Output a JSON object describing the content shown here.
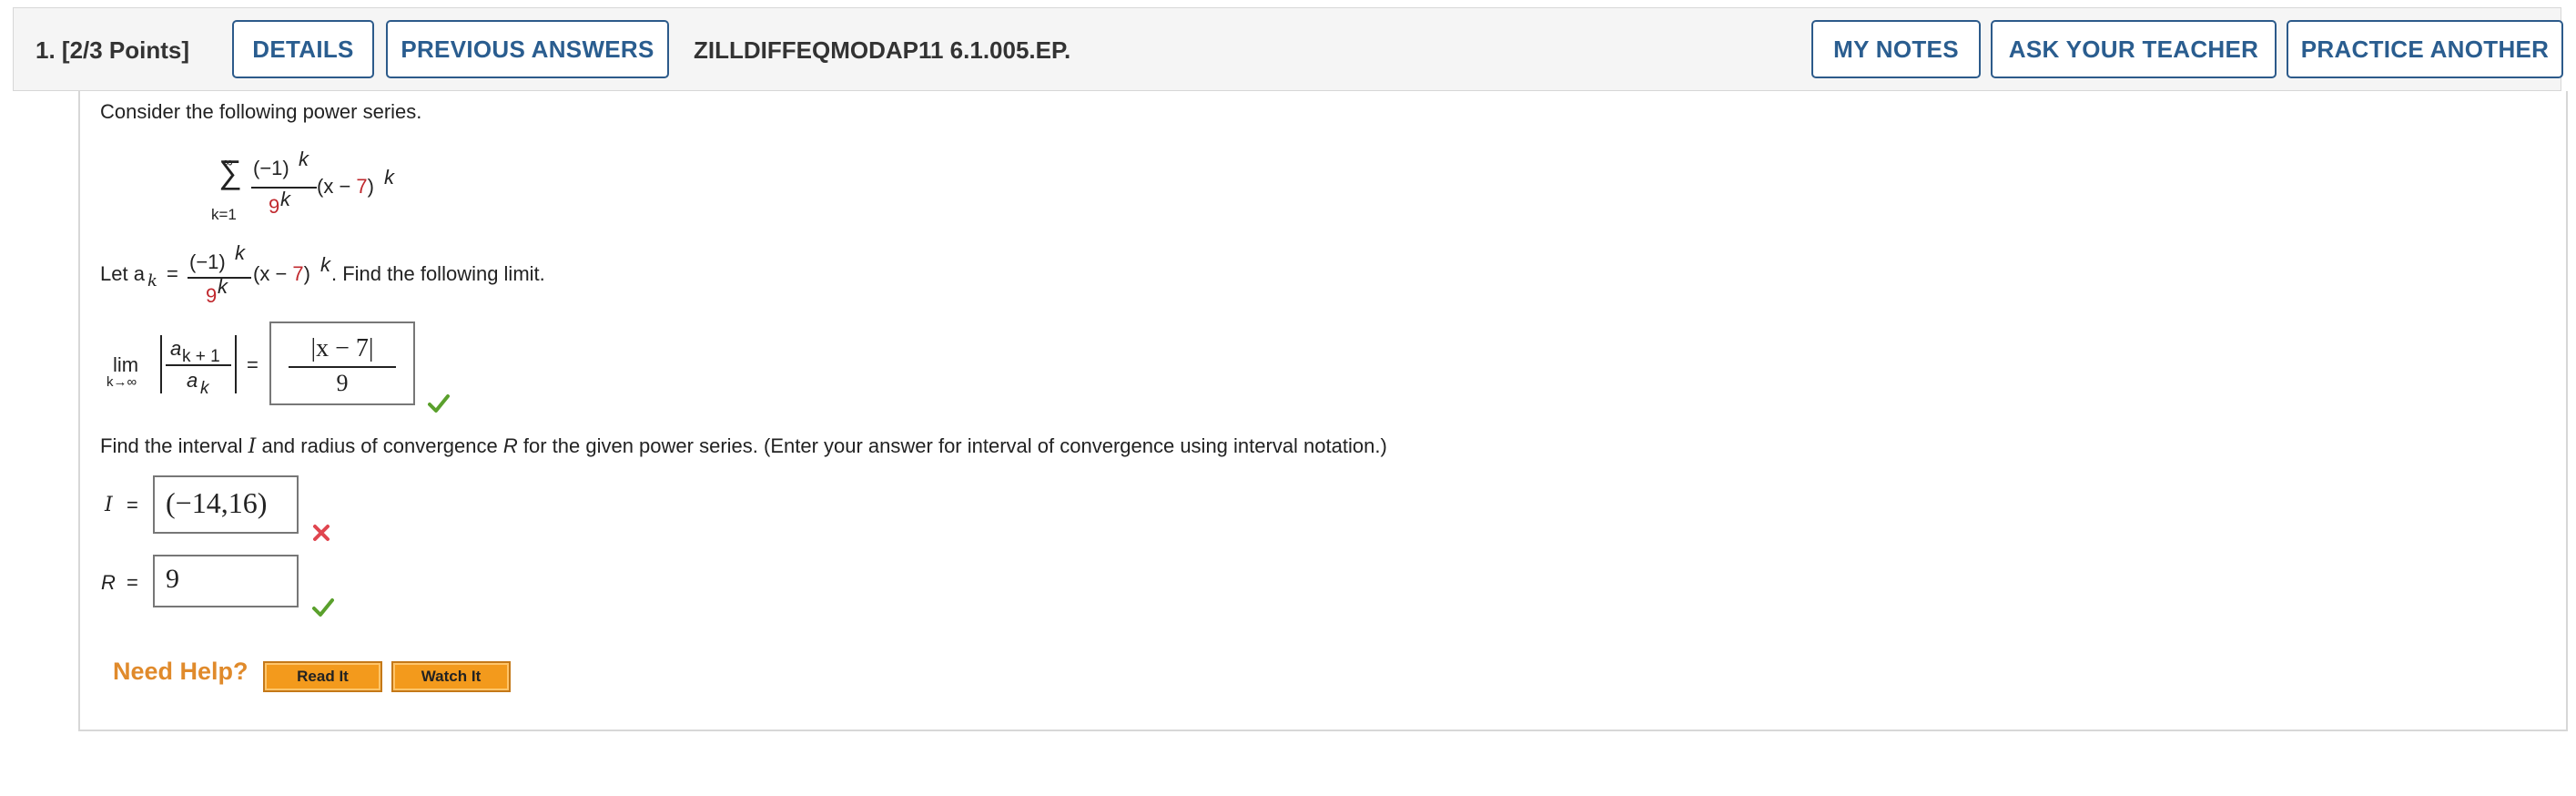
{
  "header": {
    "question_label": "1.  [2/3 Points]",
    "details_button": "DETAILS",
    "previous_answers_button": "PREVIOUS ANSWERS",
    "question_id": "ZILLDIFFEQMODAP11 6.1.005.EP.",
    "my_notes_button": "MY NOTES",
    "ask_teacher_button": "ASK YOUR TEACHER",
    "practice_another_button": "PRACTICE ANOTHER"
  },
  "question": {
    "intro": "Consider the following power series.",
    "series": {
      "sum_symbol": "∑",
      "upper": "∞",
      "lower": "k=1",
      "numerator": "(−1)",
      "numerator_exp": "k",
      "denominator": "9",
      "denominator_exp": "k",
      "term_open": "(x − ",
      "center": "7",
      "term_close": ")",
      "term_exp": "k"
    },
    "let_text": "Let a",
    "let_sub": "k",
    "let_equals": "=",
    "let_tail": ". Find the following limit.",
    "limit": {
      "lim": "lim",
      "lim_sub": "k→∞",
      "num": "a",
      "num_sub": "k + 1",
      "den": "a",
      "den_sub": "k",
      "equals": "="
    },
    "limit_answer": {
      "numerator": "|x − 7|",
      "denominator": "9",
      "status": "correct"
    },
    "interval_prompt_before_I": "Find the interval ",
    "interval_I": "I",
    "interval_prompt_mid": " and radius of convergence ",
    "interval_R": "R",
    "interval_prompt_after": " for the given power series. (Enter your answer for interval of convergence using interval notation.)",
    "I_label": "I",
    "I_equals": "=",
    "I_answer": "(−14,16)",
    "I_status": "incorrect",
    "R_label": "R",
    "R_equals": "=",
    "R_answer": "9",
    "R_status": "correct"
  },
  "help": {
    "label": "Need Help?",
    "read_it": "Read It",
    "watch_it": "Watch It"
  },
  "colors": {
    "accent_blue": "#2a5d8f",
    "highlight_red": "#c0282d",
    "correct_green": "#5aa02c",
    "incorrect_red": "#e0454f",
    "help_orange": "#e08a2b"
  }
}
